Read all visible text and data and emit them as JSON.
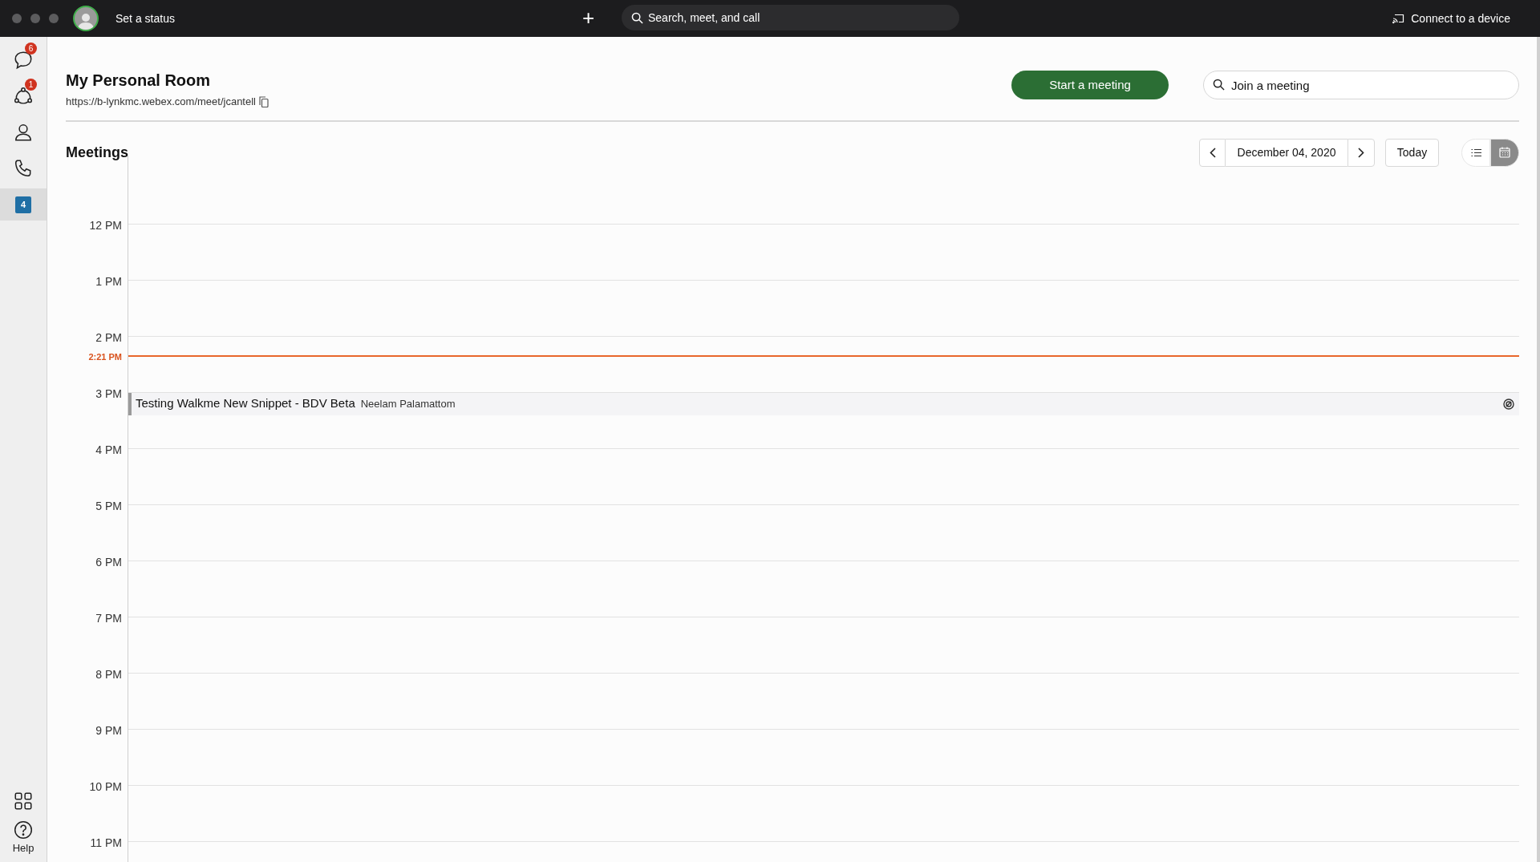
{
  "title_bar": {
    "status": "Set a status",
    "new_icon": "+",
    "search": {
      "placeholder": "Search, meet, and call"
    },
    "connect": "Connect to a device"
  },
  "sidebar": {
    "items": [
      {
        "kind": "chat",
        "badge": "6",
        "selected": false
      },
      {
        "kind": "teams",
        "badge": "1",
        "selected": false
      },
      {
        "kind": "contacts",
        "selected": false
      },
      {
        "kind": "calls",
        "selected": false
      },
      {
        "kind": "calendar",
        "day": "4",
        "selected": true
      }
    ],
    "bottom": [
      {
        "kind": "apps"
      },
      {
        "kind": "help",
        "label": "Help"
      }
    ]
  },
  "personal_room": {
    "title": "My Personal Room",
    "url": "https://b-lynkmc.webex.com/meet/jcantell",
    "start_button": "Start a meeting",
    "join": {
      "placeholder": "Join a meeting"
    }
  },
  "meetings": {
    "title": "Meetings",
    "date": "December 04, 2020",
    "today_button": "Today",
    "views": [
      {
        "kind": "list",
        "selected": false
      },
      {
        "kind": "calendar",
        "selected": true
      }
    ],
    "now_label": "2:21 PM",
    "hours": [
      {
        "label": "12 PM"
      },
      {
        "label": "1 PM"
      },
      {
        "label": "2 PM",
        "now": true
      },
      {
        "label": "3 PM",
        "meetings": [
          {
            "title": "Testing Walkme New Snippet - BDV Beta",
            "host": "Neelam Palamattom"
          }
        ]
      },
      {
        "label": "4 PM"
      },
      {
        "label": "5 PM"
      },
      {
        "label": "6 PM"
      },
      {
        "label": "7 PM"
      },
      {
        "label": "8 PM"
      },
      {
        "label": "9 PM"
      },
      {
        "label": "10 PM"
      },
      {
        "label": "11 PM"
      }
    ]
  }
}
